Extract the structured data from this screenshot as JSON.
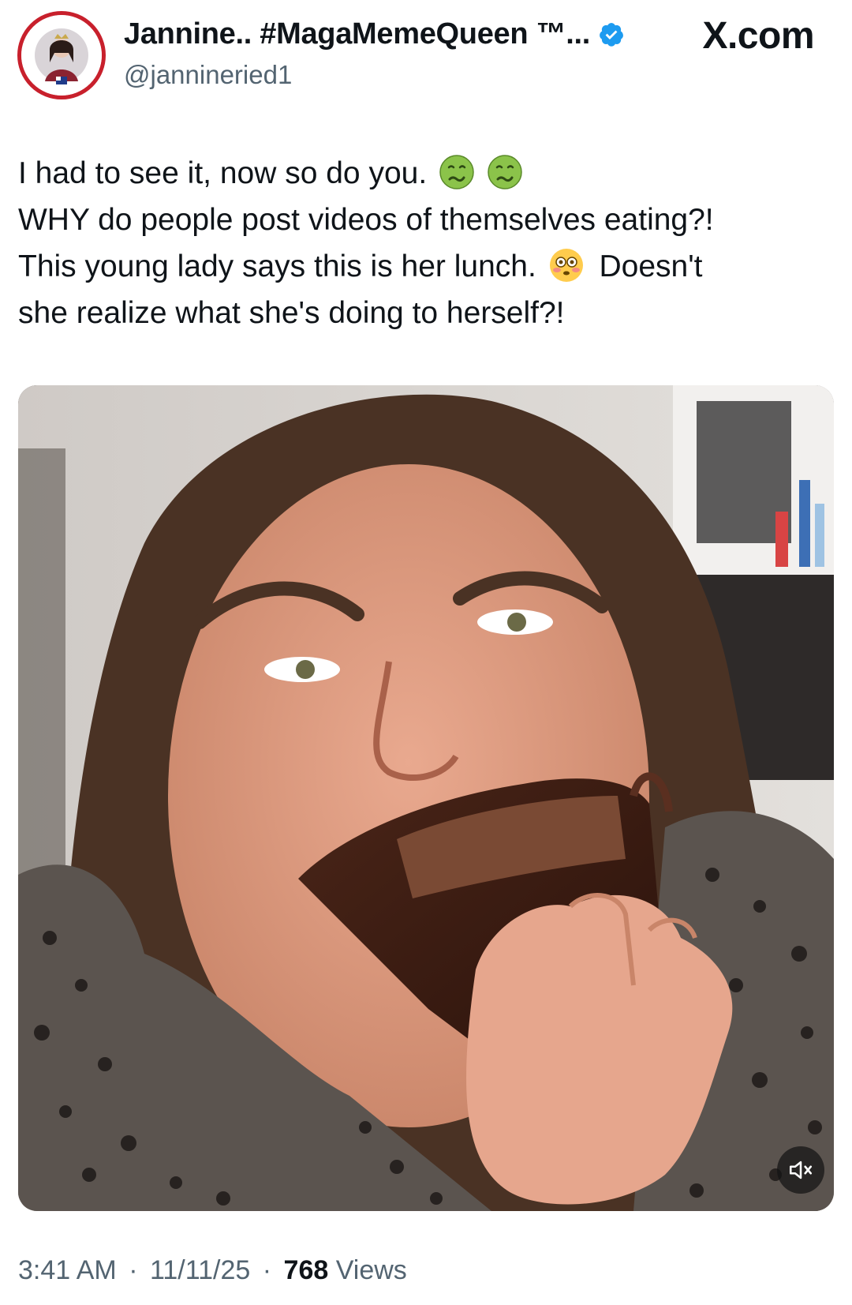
{
  "author": {
    "display_name": "Jannine.. #MagaMemeQueen ™...",
    "handle": "@jannineried1",
    "verified": true,
    "avatar_text_top": "JANNINE",
    "avatar_text_left": "Patriot Warriors",
    "avatar_text_right": "Patriot Warriors"
  },
  "source": {
    "label": "X.com"
  },
  "tweet": {
    "line1": "I had to see it, now so do you.",
    "line2": "WHY do people post videos of themselves eating?!",
    "line3a": "This young lady says this is her lunch.",
    "line3b": "Doesn't",
    "line4": "she realize what she's doing to herself?!",
    "emojis": [
      "nauseated-face-icon",
      "nauseated-face-icon",
      "flushed-face-icon"
    ]
  },
  "media": {
    "type": "video",
    "muted": true
  },
  "meta": {
    "time": "3:41 AM",
    "date": "11/11/25",
    "views_count": "768",
    "views_label": "Views",
    "separator": "·"
  },
  "colors": {
    "text": "#0f1419",
    "secondary": "#536471",
    "verified": "#1d9bf0",
    "avatar_ring": "#c8202c"
  }
}
